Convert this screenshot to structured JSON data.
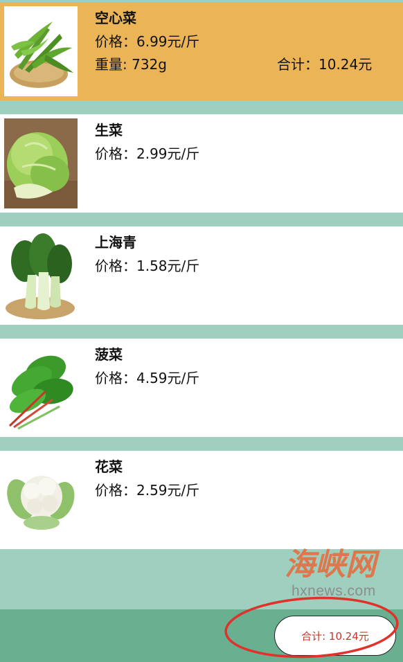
{
  "products": [
    {
      "name": "空心菜",
      "price": "价格：6.99元/斤",
      "weight": "重量: 732g",
      "subtotal": "合计：10.24元",
      "image": "water-spinach-photo",
      "selected": true
    },
    {
      "name": "生菜",
      "price": "价格：2.99元/斤",
      "image": "lettuce-photo",
      "selected": false
    },
    {
      "name": "上海青",
      "price": "价格：1.58元/斤",
      "image": "bok-choy-photo",
      "selected": false
    },
    {
      "name": "菠菜",
      "price": "价格：4.59元/斤",
      "image": "spinach-photo",
      "selected": false
    },
    {
      "name": "花菜",
      "price": "价格：2.59元/斤",
      "image": "cauliflower-photo",
      "selected": false
    }
  ],
  "watermark": {
    "brand": "海峡网",
    "url": "hxnews.com"
  },
  "footer": {
    "total_label": "合计: 10.24元"
  },
  "colors": {
    "background": "#9ecfbf",
    "selected_row": "#eab457",
    "footer_bar": "#68b08f",
    "total_text": "#c0392b",
    "annotation_circle": "#e0312b",
    "watermark_brand": "#e8673a"
  }
}
